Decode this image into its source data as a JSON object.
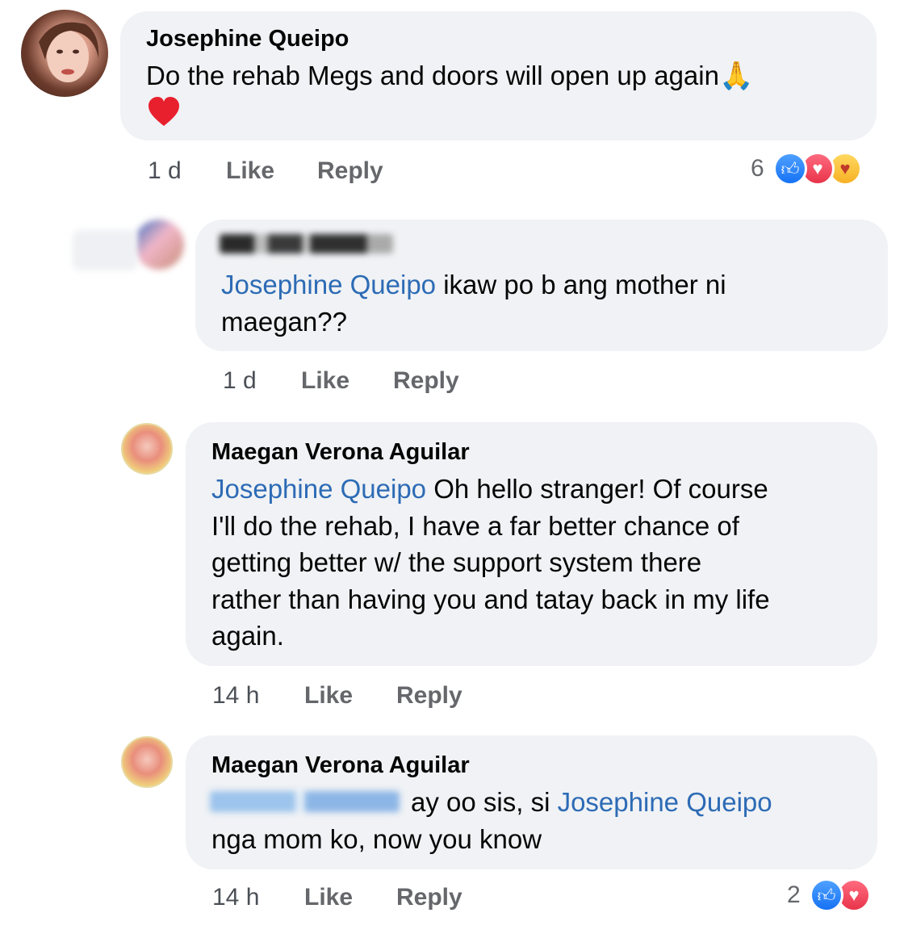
{
  "comments": [
    {
      "author": "Josephine Queipo",
      "text": "Do the rehab Megs and doors will open up again",
      "time": "1 d",
      "like": "Like",
      "reply": "Reply",
      "reaction_count": "6",
      "reactions": [
        "like-icon",
        "love-icon",
        "care-icon"
      ]
    },
    {
      "mention": "Josephine Queipo",
      "text_line1": " ikaw po b ang mother ni",
      "text_line2": "maegan??",
      "time": "1 d",
      "like": "Like",
      "reply": "Reply"
    },
    {
      "author": "Maegan Verona Aguilar",
      "mention": "Josephine Queipo",
      "text_line1": " Oh hello stranger! Of course",
      "text_line2": "I'll do the rehab, I have a far better chance of",
      "text_line3": "getting better w/ the support system there",
      "text_line4": "rather than having you and tatay back in my life",
      "text_line5": "again.",
      "time": "14 h",
      "like": "Like",
      "reply": "Reply"
    },
    {
      "author": "Maegan Verona Aguilar",
      "text_part1": "ay oo sis, si ",
      "mention": "Josephine Queipo",
      "text_line2": "nga mom ko, now you know",
      "time": "14 h",
      "like": "Like",
      "reply": "Reply",
      "reaction_count": "2",
      "reactions": [
        "like-icon",
        "love-icon"
      ]
    }
  ],
  "colors": {
    "bubble": "#f0f2f5",
    "mention": "#2d6bb5",
    "meta": "#65676b",
    "like": "#1672f5",
    "love": "#e8344a"
  }
}
